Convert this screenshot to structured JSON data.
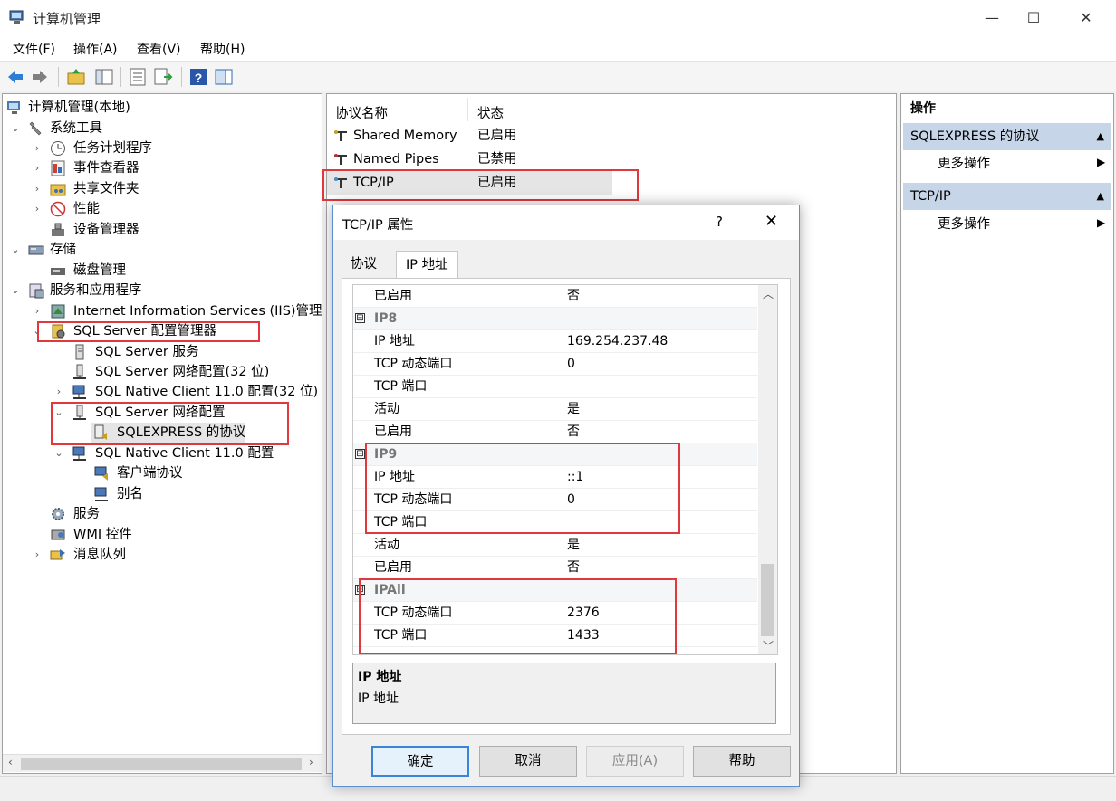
{
  "window": {
    "title": "计算机管理"
  },
  "menu": [
    "文件(F)",
    "操作(A)",
    "查看(V)",
    "帮助(H)"
  ],
  "tree": {
    "root": "计算机管理(本地)",
    "system_tools": "系统工具",
    "task_scheduler": "任务计划程序",
    "event_viewer": "事件查看器",
    "shared_folders": "共享文件夹",
    "performance": "性能",
    "device_manager": "设备管理器",
    "storage": "存储",
    "disk_management": "磁盘管理",
    "services_apps": "服务和应用程序",
    "iis": "Internet Information Services (IIS)管理器",
    "sql_config_mgr": "SQL Server 配置管理器",
    "sql_services": "SQL Server 服务",
    "sql_net_32": "SQL Server 网络配置(32 位)",
    "native_client_32": "SQL Native Client 11.0 配置(32 位)",
    "sql_net": "SQL Server 网络配置",
    "sqlexpress_protocols": "SQLEXPRESS 的协议",
    "native_client": "SQL Native Client 11.0 配置",
    "client_protocols": "客户端协议",
    "aliases": "别名",
    "services": "服务",
    "wmi": "WMI 控件",
    "message_queue": "消息队列"
  },
  "list": {
    "col_name": "协议名称",
    "col_status": "状态",
    "rows": [
      {
        "name": "Shared Memory",
        "status": "已启用"
      },
      {
        "name": "Named Pipes",
        "status": "已禁用"
      },
      {
        "name": "TCP/IP",
        "status": "已启用"
      }
    ]
  },
  "actions": {
    "header": "操作",
    "section1": "SQLEXPRESS 的协议",
    "more1": "更多操作",
    "section2": "TCP/IP",
    "more2": "更多操作"
  },
  "dialog": {
    "title": "TCP/IP 属性",
    "help": "?",
    "tabs": [
      "协议",
      "IP 地址"
    ],
    "rows": {
      "r0": {
        "name": "已启用",
        "value": "否"
      },
      "ip8": {
        "name": "IP8"
      },
      "r1": {
        "name": "IP 地址",
        "value": "169.254.237.48"
      },
      "r2": {
        "name": "TCP 动态端口",
        "value": "0"
      },
      "r3": {
        "name": "TCP 端口",
        "value": ""
      },
      "r4": {
        "name": "活动",
        "value": "是"
      },
      "r5": {
        "name": "已启用",
        "value": "否"
      },
      "ip9": {
        "name": "IP9"
      },
      "r6": {
        "name": "IP 地址",
        "value": "::1"
      },
      "r7": {
        "name": "TCP 动态端口",
        "value": "0"
      },
      "r8": {
        "name": "TCP 端口",
        "value": ""
      },
      "r9": {
        "name": "活动",
        "value": "是"
      },
      "r10": {
        "name": "已启用",
        "value": "否"
      },
      "ipall": {
        "name": "IPAll"
      },
      "r11": {
        "name": "TCP 动态端口",
        "value": "2376"
      },
      "r12": {
        "name": "TCP 端口",
        "value": "1433"
      }
    },
    "expander": "⊟",
    "desc_title": "IP 地址",
    "desc_text": "IP 地址",
    "buttons": {
      "ok": "确定",
      "cancel": "取消",
      "apply": "应用(A)",
      "help": "帮助"
    }
  },
  "colors": {
    "highlight": "#e0383c",
    "section_bg": "#c6d6e8",
    "selected_bg": "#e5e5e5"
  }
}
